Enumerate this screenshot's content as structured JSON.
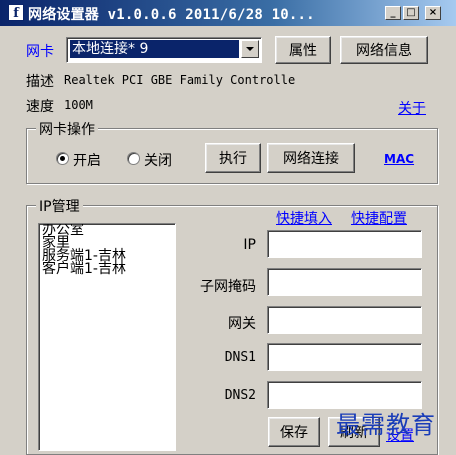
{
  "window": {
    "title": "网络设置器 v1.0.0.6 2011/6/28 10...",
    "icon_glyph": "f",
    "minimize": "_",
    "maximize": "□",
    "close": "×"
  },
  "adapter": {
    "label": "网卡",
    "selected": "本地连接* 9",
    "properties_button": "属性",
    "network_info_button": "网络信息",
    "description_label": "描述",
    "description_value": "Realtek PCI GBE Family Controlle",
    "speed_label": "速度",
    "speed_value": "100M",
    "about_link": "关于"
  },
  "adapter_ops": {
    "legend": "网卡操作",
    "enable_label": "开启",
    "disable_label": "关闭",
    "selected": "enable",
    "execute_button": "执行",
    "network_connections_button": "网络连接",
    "mac_link": "MAC"
  },
  "ip_management": {
    "legend": "IP管理",
    "quick_fill_link": "快捷填入",
    "quick_config_link": "快捷配置",
    "profiles": [
      "办公室",
      "家里",
      "服务端1-吉林",
      "客户端1-吉林"
    ],
    "fields": {
      "ip_label": "IP",
      "ip_value": "",
      "mask_label": "子网掩码",
      "mask_value": "",
      "gateway_label": "网关",
      "gateway_value": "",
      "dns1_label": "DNS1",
      "dns1_value": "",
      "dns2_label": "DNS2",
      "dns2_value": ""
    },
    "save_button": "保存",
    "second_button": "刷新",
    "third_link": "设置"
  },
  "watermark": "最需教育",
  "colors": {
    "face": "#d4d0c8",
    "title_start": "#0a246a",
    "selection": "#0a246a",
    "link": "#0000ff"
  }
}
